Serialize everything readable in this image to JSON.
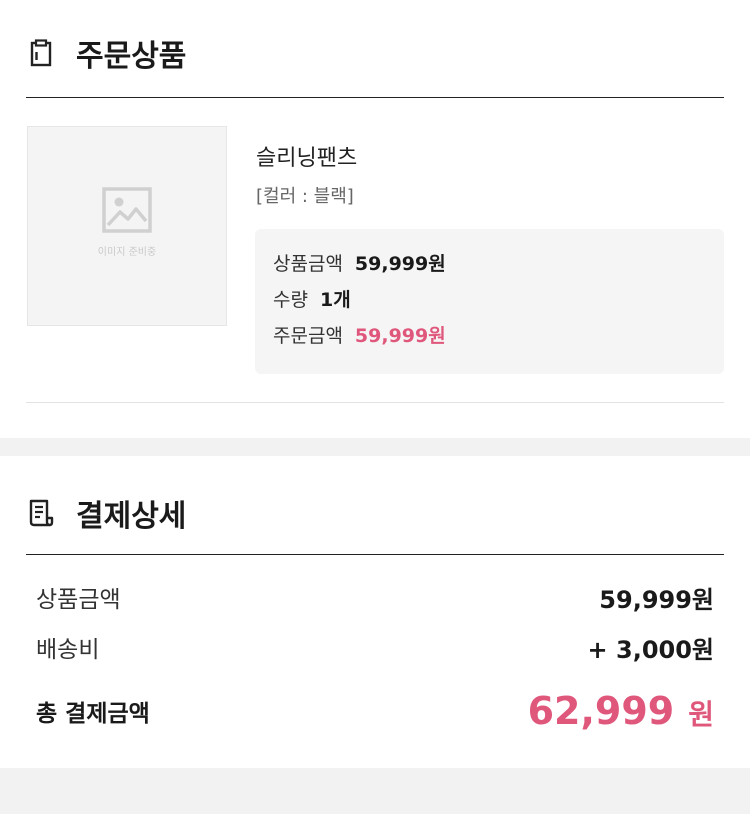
{
  "order": {
    "title": "주문상품",
    "icon": "clipboard-icon",
    "thumbnail": {
      "icon": "image-placeholder-icon",
      "caption": "이미지 준비중"
    },
    "product_name": "슬리닝팬츠",
    "option": "[컬러 : 블랙]",
    "price_box": {
      "product_price_label": "상품금액",
      "product_price_value": "59,999원",
      "quantity_label": "수량",
      "quantity_value": "1개",
      "order_price_label": "주문금액",
      "order_price_value": "59,999원"
    }
  },
  "payment": {
    "title": "결제상세",
    "icon": "receipt-icon",
    "product_price_label": "상품금액",
    "product_price_value": "59,999원",
    "shipping_label": "배송비",
    "shipping_value": "+ 3,000원",
    "total_label": "총 결제금액",
    "total_amount": "62,999",
    "total_unit": "원"
  },
  "colors": {
    "accent": "#e0577c",
    "divider": "#222222",
    "box_bg": "#f5f5f5",
    "gap_bg": "#f2f2f2"
  }
}
